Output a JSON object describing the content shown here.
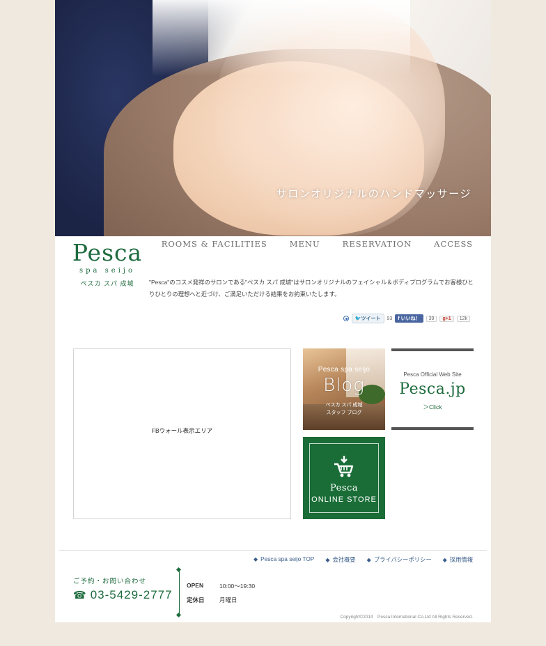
{
  "hero": {
    "caption": "サロンオリジナルのハンドマッサージ"
  },
  "logo": {
    "mark": "Pesca",
    "sub": "spa seijo",
    "kana": "ペスカ スパ 成城"
  },
  "nav": {
    "items": [
      "ROOMS & FACILITIES",
      "MENU",
      "RESERVATION",
      "ACCESS"
    ]
  },
  "intro": {
    "text": "\"Pesca\"のコスメ発祥のサロンである\"ペスカ スパ 成城\"はサロンオリジナルのフェイシャル＆ボディプログラムでお客様ひとりひとりの理想へと近づけ、ご満足いただける結果をお約束いたします。"
  },
  "social": {
    "tweet_label": "ツイート",
    "tweet_count": "93",
    "like_label": "いいね！",
    "like_count": "39",
    "plusone_label": "+1",
    "plusone_count": "12k"
  },
  "fbwall": {
    "text": "FBウォール表示エリア"
  },
  "blog": {
    "line1": "Pesca spa seijo",
    "title": "Blog",
    "line3": "ペスカ スパ 成城",
    "line4": "スタッフ ブログ"
  },
  "official": {
    "line1": "Pesca Official Web Site",
    "title": "Pesca.jp",
    "link": "＞Click"
  },
  "store": {
    "line1": "Pesca",
    "line2": "ONLINE STORE"
  },
  "footer": {
    "links": [
      "Pesca spa seijo TOP",
      "会社概要",
      "プライバシーポリシー",
      "採用情報"
    ],
    "contact_label": "ご予約・お問い合わせ",
    "phone": "03-5429-2777",
    "open_label": "OPEN",
    "open_value": "10:00〜19:30",
    "closed_label": "定休日",
    "closed_value": "月曜日",
    "copyright": "Copyright©2014　Pesca International Co.Ltd All Rights Reserved."
  },
  "colors": {
    "brand_green": "#1e6b3e",
    "store_green": "#1a6d37",
    "background": "#efe9df"
  }
}
